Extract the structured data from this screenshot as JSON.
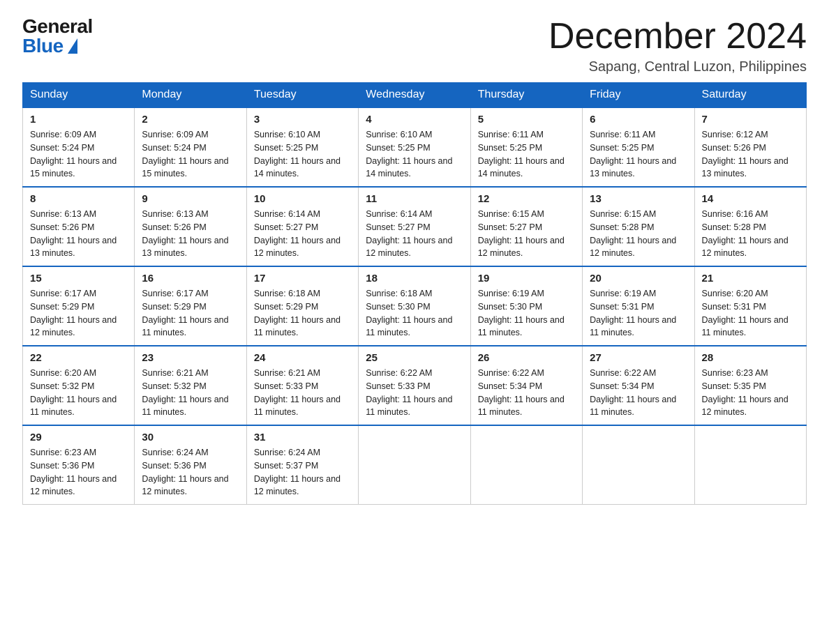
{
  "logo": {
    "general": "General",
    "blue": "Blue"
  },
  "title": {
    "month": "December 2024",
    "location": "Sapang, Central Luzon, Philippines"
  },
  "weekdays": [
    "Sunday",
    "Monday",
    "Tuesday",
    "Wednesday",
    "Thursday",
    "Friday",
    "Saturday"
  ],
  "weeks": [
    [
      {
        "day": "1",
        "sunrise": "6:09 AM",
        "sunset": "5:24 PM",
        "daylight": "11 hours and 15 minutes."
      },
      {
        "day": "2",
        "sunrise": "6:09 AM",
        "sunset": "5:24 PM",
        "daylight": "11 hours and 15 minutes."
      },
      {
        "day": "3",
        "sunrise": "6:10 AM",
        "sunset": "5:25 PM",
        "daylight": "11 hours and 14 minutes."
      },
      {
        "day": "4",
        "sunrise": "6:10 AM",
        "sunset": "5:25 PM",
        "daylight": "11 hours and 14 minutes."
      },
      {
        "day": "5",
        "sunrise": "6:11 AM",
        "sunset": "5:25 PM",
        "daylight": "11 hours and 14 minutes."
      },
      {
        "day": "6",
        "sunrise": "6:11 AM",
        "sunset": "5:25 PM",
        "daylight": "11 hours and 13 minutes."
      },
      {
        "day": "7",
        "sunrise": "6:12 AM",
        "sunset": "5:26 PM",
        "daylight": "11 hours and 13 minutes."
      }
    ],
    [
      {
        "day": "8",
        "sunrise": "6:13 AM",
        "sunset": "5:26 PM",
        "daylight": "11 hours and 13 minutes."
      },
      {
        "day": "9",
        "sunrise": "6:13 AM",
        "sunset": "5:26 PM",
        "daylight": "11 hours and 13 minutes."
      },
      {
        "day": "10",
        "sunrise": "6:14 AM",
        "sunset": "5:27 PM",
        "daylight": "11 hours and 12 minutes."
      },
      {
        "day": "11",
        "sunrise": "6:14 AM",
        "sunset": "5:27 PM",
        "daylight": "11 hours and 12 minutes."
      },
      {
        "day": "12",
        "sunrise": "6:15 AM",
        "sunset": "5:27 PM",
        "daylight": "11 hours and 12 minutes."
      },
      {
        "day": "13",
        "sunrise": "6:15 AM",
        "sunset": "5:28 PM",
        "daylight": "11 hours and 12 minutes."
      },
      {
        "day": "14",
        "sunrise": "6:16 AM",
        "sunset": "5:28 PM",
        "daylight": "11 hours and 12 minutes."
      }
    ],
    [
      {
        "day": "15",
        "sunrise": "6:17 AM",
        "sunset": "5:29 PM",
        "daylight": "11 hours and 12 minutes."
      },
      {
        "day": "16",
        "sunrise": "6:17 AM",
        "sunset": "5:29 PM",
        "daylight": "11 hours and 11 minutes."
      },
      {
        "day": "17",
        "sunrise": "6:18 AM",
        "sunset": "5:29 PM",
        "daylight": "11 hours and 11 minutes."
      },
      {
        "day": "18",
        "sunrise": "6:18 AM",
        "sunset": "5:30 PM",
        "daylight": "11 hours and 11 minutes."
      },
      {
        "day": "19",
        "sunrise": "6:19 AM",
        "sunset": "5:30 PM",
        "daylight": "11 hours and 11 minutes."
      },
      {
        "day": "20",
        "sunrise": "6:19 AM",
        "sunset": "5:31 PM",
        "daylight": "11 hours and 11 minutes."
      },
      {
        "day": "21",
        "sunrise": "6:20 AM",
        "sunset": "5:31 PM",
        "daylight": "11 hours and 11 minutes."
      }
    ],
    [
      {
        "day": "22",
        "sunrise": "6:20 AM",
        "sunset": "5:32 PM",
        "daylight": "11 hours and 11 minutes."
      },
      {
        "day": "23",
        "sunrise": "6:21 AM",
        "sunset": "5:32 PM",
        "daylight": "11 hours and 11 minutes."
      },
      {
        "day": "24",
        "sunrise": "6:21 AM",
        "sunset": "5:33 PM",
        "daylight": "11 hours and 11 minutes."
      },
      {
        "day": "25",
        "sunrise": "6:22 AM",
        "sunset": "5:33 PM",
        "daylight": "11 hours and 11 minutes."
      },
      {
        "day": "26",
        "sunrise": "6:22 AM",
        "sunset": "5:34 PM",
        "daylight": "11 hours and 11 minutes."
      },
      {
        "day": "27",
        "sunrise": "6:22 AM",
        "sunset": "5:34 PM",
        "daylight": "11 hours and 11 minutes."
      },
      {
        "day": "28",
        "sunrise": "6:23 AM",
        "sunset": "5:35 PM",
        "daylight": "11 hours and 12 minutes."
      }
    ],
    [
      {
        "day": "29",
        "sunrise": "6:23 AM",
        "sunset": "5:36 PM",
        "daylight": "11 hours and 12 minutes."
      },
      {
        "day": "30",
        "sunrise": "6:24 AM",
        "sunset": "5:36 PM",
        "daylight": "11 hours and 12 minutes."
      },
      {
        "day": "31",
        "sunrise": "6:24 AM",
        "sunset": "5:37 PM",
        "daylight": "11 hours and 12 minutes."
      },
      null,
      null,
      null,
      null
    ]
  ]
}
